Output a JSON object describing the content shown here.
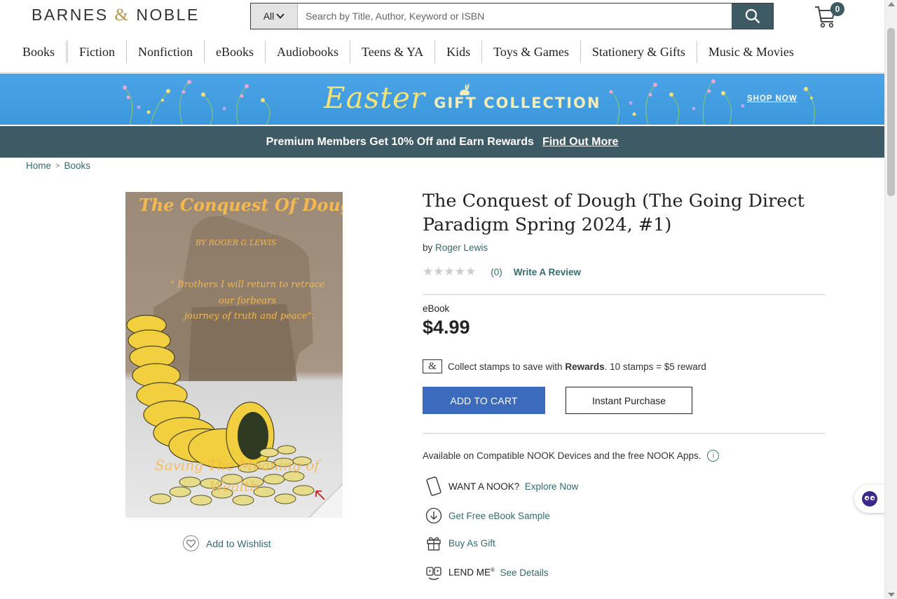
{
  "header": {
    "logo_left": "BARNES",
    "logo_amp": "&",
    "logo_right": "NOBLE",
    "search_scope": "All",
    "search_placeholder": "Search by Title, Author, Keyword or ISBN",
    "cart_count": "0"
  },
  "nav": {
    "items": [
      "Books",
      "Fiction",
      "Nonfiction",
      "eBooks",
      "Audiobooks",
      "Teens & YA",
      "Kids",
      "Toys & Games",
      "Stationery & Gifts",
      "Music & Movies"
    ]
  },
  "banner": {
    "script_text": "Easter",
    "gift_text": "GIFT COLLECTION",
    "shop_now": "SHOP NOW",
    "background_color": "#419ee2"
  },
  "promo": {
    "text": "Premium Members Get 10% Off and Earn Rewards",
    "link": "Find Out More",
    "background_color": "#3e5a64"
  },
  "breadcrumb": {
    "items": [
      "Home",
      "Books"
    ],
    "separator": ">"
  },
  "cover": {
    "title": "The Conquest Of Dough",
    "author": "BY ROGER G LEWIS",
    "quote_lines": [
      "\" Brothers I will return to retrace",
      "our forbears",
      "journey of truth and peace\"."
    ],
    "subtitle_line1": "Saving The Meaning of",
    "subtitle_line2": "Wealth"
  },
  "wishlist": {
    "label": "Add to Wishlist"
  },
  "product": {
    "title": "The Conquest of Dough (The Going Direct Paradigm Spring 2024, #1)",
    "by": "by",
    "author": "Roger Lewis",
    "stars": "★★★★★",
    "rating": 0,
    "review_count": "(0)",
    "write_review": "Write A Review",
    "format": "eBook",
    "price": "$4.99",
    "rewards_icon": "&",
    "rewards_pre": "Collect stamps to save with",
    "rewards_bold": "Rewards",
    "rewards_post": ". 10 stamps = $5 reward",
    "add_to_cart": "ADD TO CART",
    "instant_purchase": "Instant Purchase",
    "available": "Available on Compatible NOOK Devices and the free NOOK Apps.",
    "info_glyph": "i",
    "want_nook": "WANT A NOOK?",
    "explore_now": "Explore Now",
    "free_sample": "Get Free eBook Sample",
    "buy_as_gift": "Buy As Gift",
    "lend_me": "LEND ME",
    "lend_me_mark": "®",
    "see_details": "See Details",
    "accent_color": "#3c6bbd",
    "link_color": "#346b6b"
  }
}
